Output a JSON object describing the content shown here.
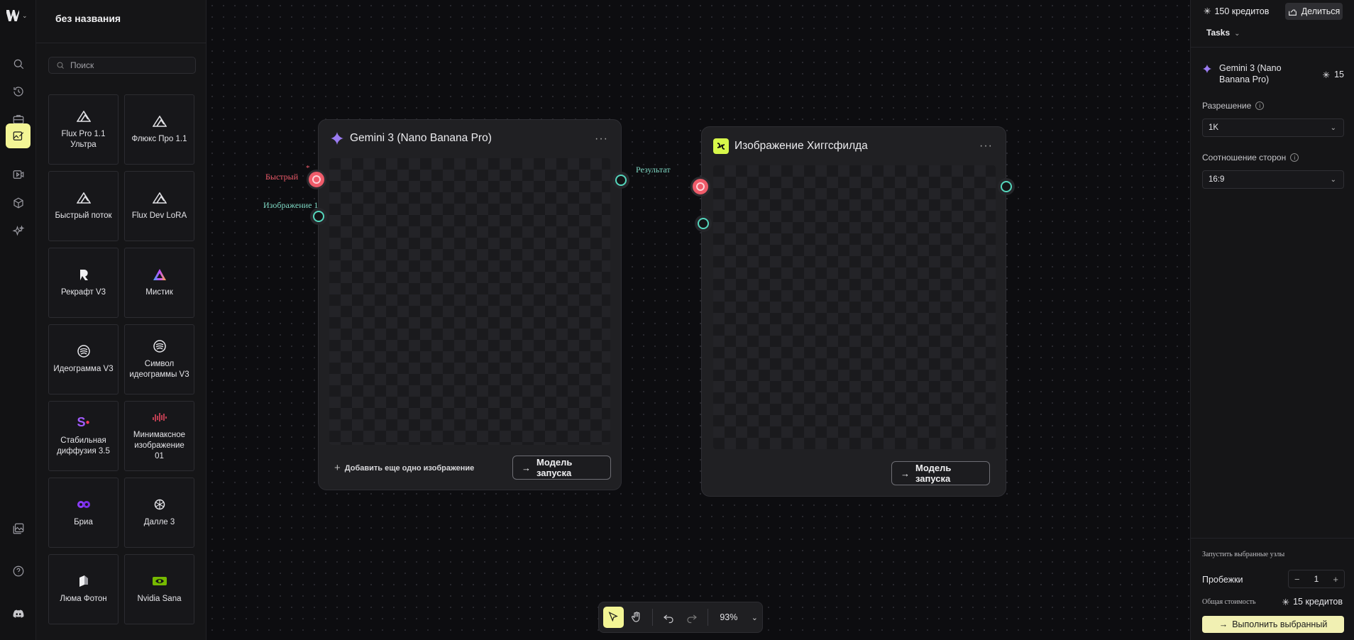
{
  "project": {
    "title": "без названия"
  },
  "library": {
    "search_placeholder": "Поиск",
    "models": [
      {
        "label": "Flux Pro 1.1 Ультра",
        "icon": "flux-icon"
      },
      {
        "label": "Флюкс Про 1.1",
        "icon": "flux-icon"
      },
      {
        "label": "Быстрый поток",
        "icon": "flux-icon"
      },
      {
        "label": "Flux Dev LoRA",
        "icon": "flux-icon"
      },
      {
        "label": "Рекрафт V3",
        "icon": "recraft-icon"
      },
      {
        "label": "Мистик",
        "icon": "mystic-icon"
      },
      {
        "label": "Идеограмма V3",
        "icon": "ideogram-icon"
      },
      {
        "label": "Символ идеограммы V3",
        "icon": "ideogram-icon"
      },
      {
        "label": "Стабильная диффузия 3.5",
        "icon": "stability-icon"
      },
      {
        "label": "Минимаксное изображение 01",
        "icon": "minimax-icon"
      },
      {
        "label": "Бриа",
        "icon": "bria-icon"
      },
      {
        "label": "Далле 3",
        "icon": "openai-icon"
      },
      {
        "label": "Люма Фотон",
        "icon": "luma-icon"
      },
      {
        "label": "Nvidia Sana",
        "icon": "nvidia-icon"
      }
    ]
  },
  "nodes": {
    "gemini": {
      "title": "Gemini 3 (Nano Banana Pro)",
      "menu": "···",
      "input_prompt_label": "Быстрый",
      "required_mark": "*",
      "input_image_label": "Изображение 1",
      "output_label": "Результат",
      "add_image_label": "Добавить еще одно изображение",
      "run_label": "Модель запуска"
    },
    "higgsfield": {
      "title": "Изображение Хиггсфилда",
      "menu": "···",
      "run_label": "Модель запуска"
    }
  },
  "toolbar": {
    "zoom": "93%"
  },
  "right_panel": {
    "credits": "150 кредитов",
    "share_label": "Делиться",
    "tasks_label": "Tasks",
    "model_name": "Gemini 3 (Nano Banana Pro)",
    "model_cost": "15",
    "resolution_label": "Разрешение",
    "resolution_value": "1K",
    "aspect_label": "Соотношение сторон",
    "aspect_value": "16:9",
    "run_selected_label": "Запустить выбранные узлы",
    "runs_label": "Пробежки",
    "runs_value": "1",
    "total_label": "Общая стоимость",
    "total_value": "15 кредитов",
    "execute_label": "Выполнить выбранный"
  },
  "colors": {
    "accent": "#f3f595",
    "prompt_port": "#ef5b6a",
    "image_port": "#55d7bd"
  }
}
